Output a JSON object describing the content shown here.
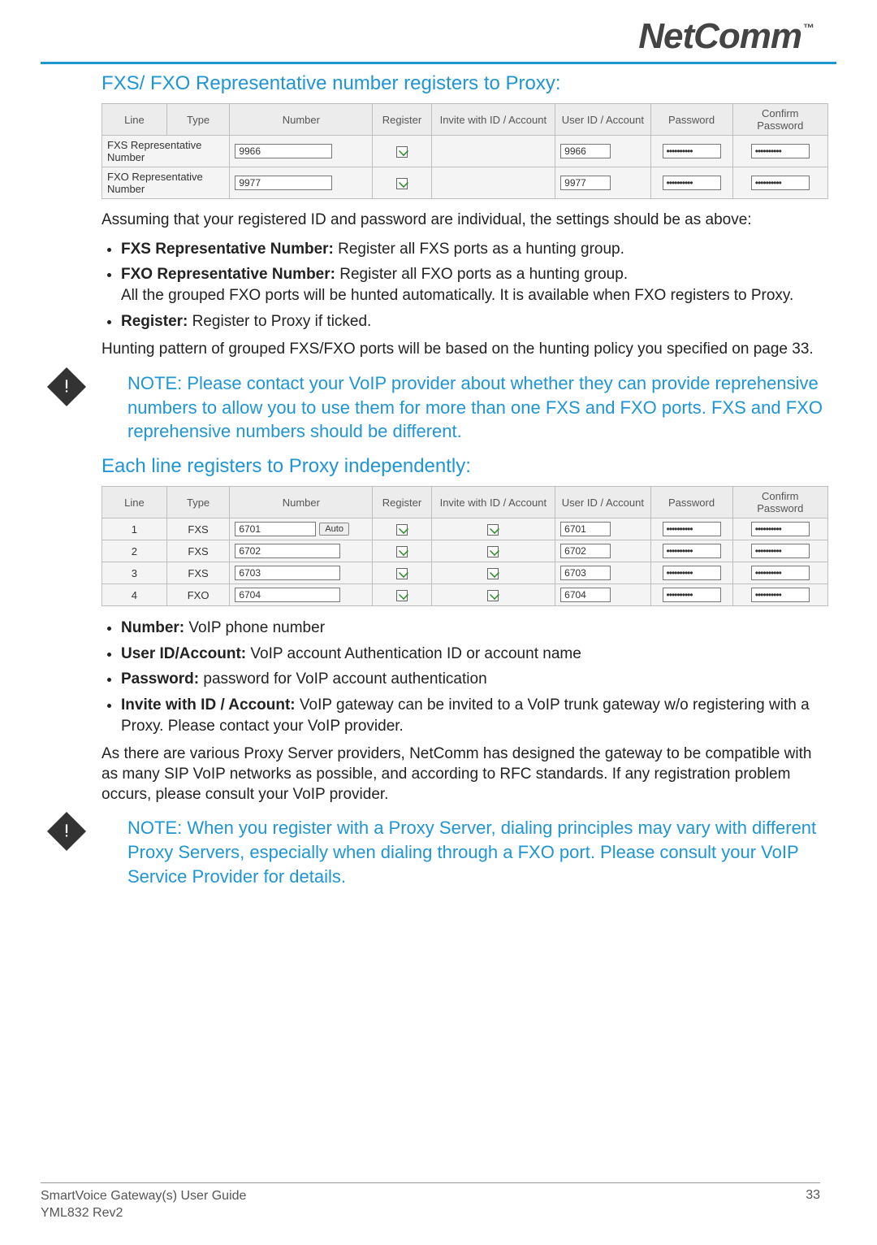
{
  "brand": {
    "name": "NetComm",
    "tm": "™"
  },
  "section1": {
    "heading": "FXS/ FXO Representative number registers to Proxy:",
    "table": {
      "headers": [
        "Line",
        "Type",
        "Number",
        "Register",
        "Invite with ID / Account",
        "User ID / Account",
        "Password",
        "Confirm Password"
      ],
      "rows": [
        {
          "line_type_label": "FXS Representative Number",
          "number": "9966",
          "register": true,
          "invite": "",
          "user": "9966",
          "password": "••••••••••",
          "confirm": "••••••••••"
        },
        {
          "line_type_label": "FXO Representative Number",
          "number": "9977",
          "register": true,
          "invite": "",
          "user": "9977",
          "password": "••••••••••",
          "confirm": "••••••••••"
        }
      ]
    },
    "intro": "Assuming that your registered ID and password are individual, the settings should be as above:",
    "bullets": [
      {
        "bold": "FXS Representative Number:",
        "text": " Register all FXS ports as a hunting group."
      },
      {
        "bold": "FXO Representative Number:",
        "text": " Register all FXO ports as a hunting group.",
        "text2": "All the grouped FXO ports will be hunted automatically. It is available when FXO registers to Proxy."
      },
      {
        "bold": "Register:",
        "text": " Register to Proxy if ticked."
      }
    ],
    "outro": "Hunting pattern of grouped FXS/FXO ports will be based on the hunting policy you specified on page 33."
  },
  "note1": "NOTE: Please contact your VoIP provider about whether they can provide reprehensive numbers to allow you to use them for more than one FXS and FXO ports. FXS and FXO reprehensive numbers should be different.",
  "section2": {
    "heading": "Each line registers to Proxy independently:",
    "table": {
      "headers": [
        "Line",
        "Type",
        "Number",
        "Register",
        "Invite with ID / Account",
        "User ID / Account",
        "Password",
        "Confirm Password"
      ],
      "rows": [
        {
          "line": "1",
          "type": "FXS",
          "number": "6701",
          "auto": "Auto",
          "register": true,
          "invite": true,
          "user": "6701",
          "password": "••••••••••",
          "confirm": "••••••••••"
        },
        {
          "line": "2",
          "type": "FXS",
          "number": "6702",
          "auto": "",
          "register": true,
          "invite": true,
          "user": "6702",
          "password": "••••••••••",
          "confirm": "••••••••••"
        },
        {
          "line": "3",
          "type": "FXS",
          "number": "6703",
          "auto": "",
          "register": true,
          "invite": true,
          "user": "6703",
          "password": "••••••••••",
          "confirm": "••••••••••"
        },
        {
          "line": "4",
          "type": "FXO",
          "number": "6704",
          "auto": "",
          "register": true,
          "invite": true,
          "user": "6704",
          "password": "••••••••••",
          "confirm": "••••••••••"
        }
      ]
    },
    "bullets": [
      {
        "bold": "Number:",
        "text": " VoIP phone number"
      },
      {
        "bold": "User ID/Account:",
        "text": " VoIP account Authentication ID or account name"
      },
      {
        "bold": "Password:",
        "text": " password for VoIP account authentication"
      },
      {
        "bold": "Invite with ID / Account:",
        "text": " VoIP gateway can be invited to a VoIP trunk gateway w/o registering with a Proxy. Please contact your VoIP provider."
      }
    ],
    "outro": "As there are various Proxy Server providers, NetComm has designed the gateway to be compatible with as many SIP VoIP networks as possible, and according to RFC standards. If any registration problem occurs, please consult your VoIP provider."
  },
  "note2": "NOTE: When you register with a Proxy Server, dialing principles may vary with different Proxy Servers, especially when dialing through a FXO port. Please consult your VoIP Service Provider for details.",
  "footer": {
    "title": "SmartVoice Gateway(s) User Guide",
    "rev": "YML832 Rev2",
    "page": "33"
  }
}
